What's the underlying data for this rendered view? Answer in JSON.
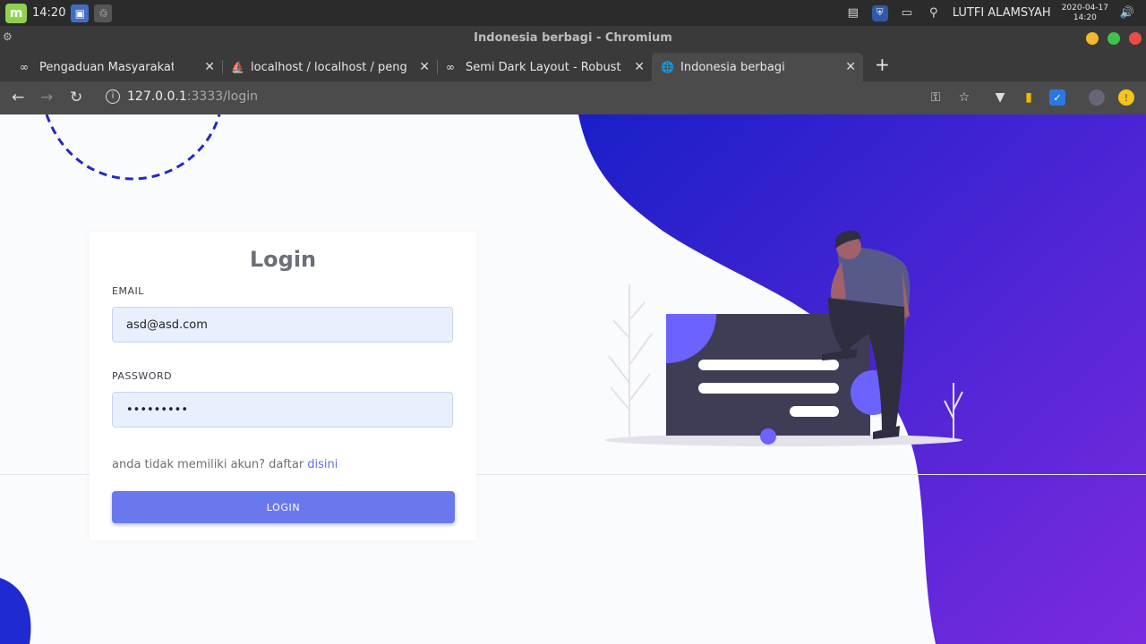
{
  "taskbar": {
    "time": "14:20",
    "user": "LUTFI ALAMSYAH",
    "date": "2020-04-17",
    "time_small": "14:20"
  },
  "window": {
    "title": "Indonesia berbagi - Chromium"
  },
  "tabs": [
    {
      "label": "Pengaduan Masyarakat",
      "icon": "infinity-icon"
    },
    {
      "label": "localhost / localhost / pengad",
      "icon": "phpmyadmin-icon"
    },
    {
      "label": "Semi Dark Layout - Robust Fr",
      "icon": "infinity-icon"
    },
    {
      "label": "Indonesia berbagi",
      "icon": "globe-icon",
      "active": true
    }
  ],
  "address": {
    "host": "127.0.0.1",
    "path": ":3333/login"
  },
  "login": {
    "title": "Login",
    "email_label": "EMAIL",
    "email_value": "asd@asd.com",
    "password_label": "PASSWORD",
    "password_value": "•••••••••",
    "hint_text": "anda tidak memiliki akun? daftar ",
    "hint_link": "disini",
    "button_label": "LOGIN"
  },
  "colors": {
    "accent": "#6a78ee",
    "gradient_start": "#1a1fc8",
    "gradient_end": "#7a2ae0"
  }
}
